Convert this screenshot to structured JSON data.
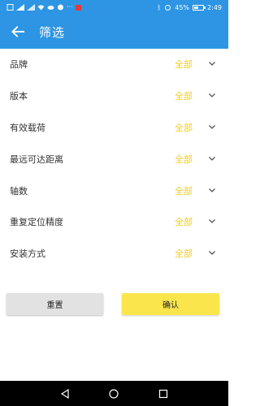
{
  "status_bar": {
    "bluetooth": "ᛒ",
    "battery_text": "45%",
    "battery_level": 0.45,
    "time": "2:49",
    "accent": "#2d95e3"
  },
  "header": {
    "back_icon": "arrow-left-icon",
    "title": "筛选"
  },
  "filters": [
    {
      "label": "品牌",
      "value": "全部"
    },
    {
      "label": "版本",
      "value": "全部"
    },
    {
      "label": "有效载荷",
      "value": "全部"
    },
    {
      "label": "最远可达距离",
      "value": "全部"
    },
    {
      "label": "轴数",
      "value": "全部"
    },
    {
      "label": "重复定位精度",
      "value": "全部"
    },
    {
      "label": "安装方式",
      "value": "全部"
    }
  ],
  "actions": {
    "reset_label": "重置",
    "confirm_label": "确认"
  },
  "colors": {
    "primary": "#2d95e3",
    "value_text": "#f2cc1f",
    "confirm_bg": "#fbe54d",
    "reset_bg": "#e2e2e2"
  }
}
